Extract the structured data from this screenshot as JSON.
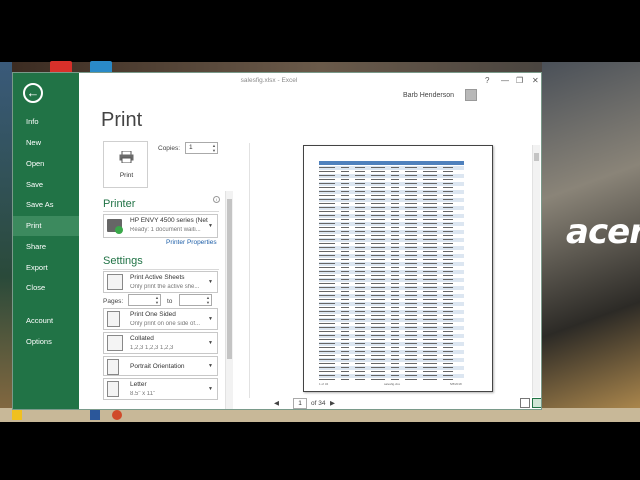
{
  "window": {
    "title": "salesfig.xlsx - Excel",
    "user": "Barb Henderson",
    "controls": [
      "?",
      "—",
      "❐",
      "✕"
    ]
  },
  "backstage": {
    "items": [
      {
        "label": "Info"
      },
      {
        "label": "New"
      },
      {
        "label": "Open"
      },
      {
        "label": "Save"
      },
      {
        "label": "Save As"
      },
      {
        "label": "Print",
        "active": true
      },
      {
        "label": "Share"
      },
      {
        "label": "Export"
      },
      {
        "label": "Close"
      },
      {
        "label": "Account"
      },
      {
        "label": "Options"
      }
    ]
  },
  "print": {
    "heading": "Print",
    "button_label": "Print",
    "copies_label": "Copies:",
    "copies_value": "1"
  },
  "printer": {
    "heading": "Printer",
    "name": "HP ENVY 4500 series (Net...",
    "status": "Ready: 1 document waiti...",
    "properties_link": "Printer Properties"
  },
  "settings": {
    "heading": "Settings",
    "active_sheets": {
      "main": "Print Active Sheets",
      "sub": "Only print the active she..."
    },
    "pages_label": "Pages:",
    "to_label": "to",
    "sided": {
      "main": "Print One Sided",
      "sub": "Only print on one side of..."
    },
    "collated": {
      "main": "Collated",
      "sub": "1,2,3    1,2,3    1,2,3"
    },
    "orientation": {
      "main": "Portrait Orientation"
    },
    "paper": {
      "main": "Letter",
      "sub": "8.5\" x 11\""
    }
  },
  "preview": {
    "current_page": "1",
    "total_pages": "of 34",
    "footer_left": "1 of 34",
    "footer_center": "salesfig.xlsx",
    "footer_right": "5/8/2018"
  },
  "desktop": {
    "brand": "acer"
  },
  "colors": {
    "excel_green": "#217346",
    "active_nav": "#3c8a5e",
    "header_blue": "#4f81bd",
    "link": "#1e5fa8"
  }
}
